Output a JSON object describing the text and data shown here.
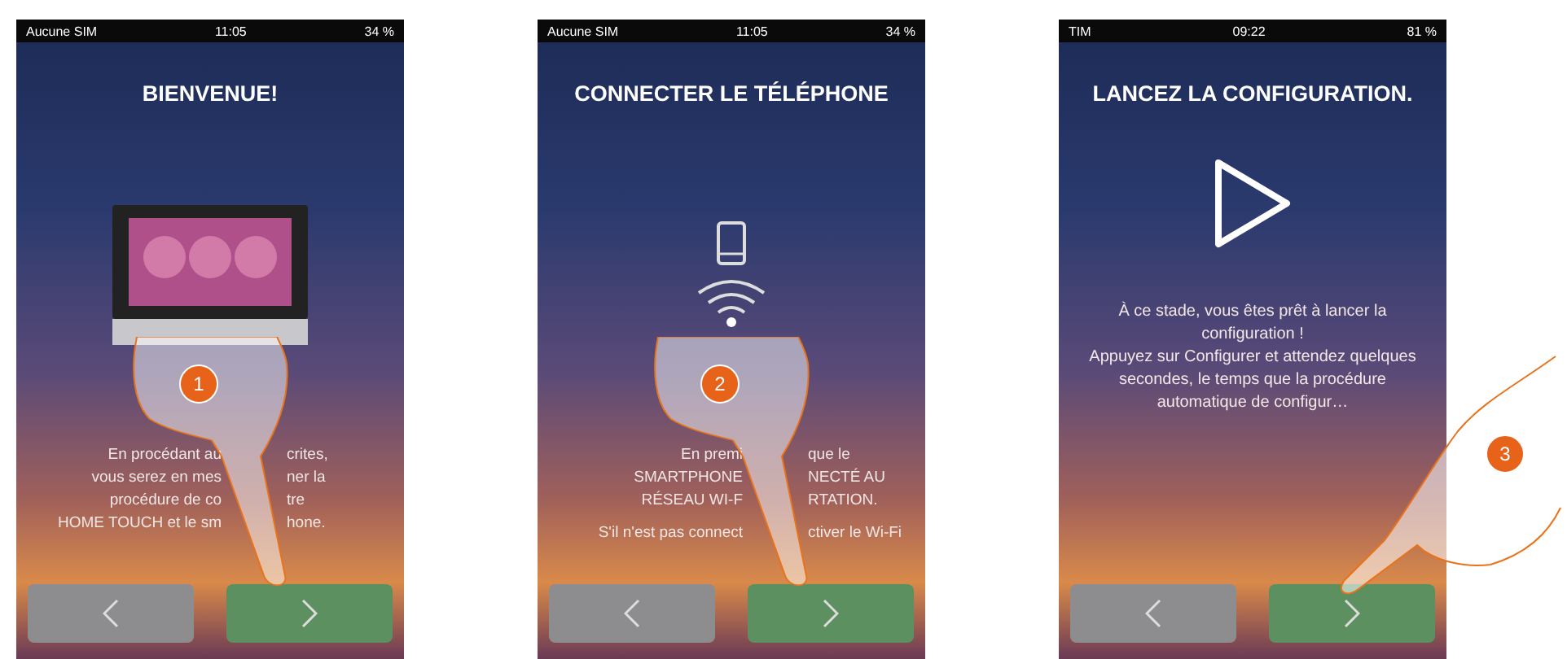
{
  "screens": [
    {
      "status": {
        "carrier": "Aucune SIM",
        "time": "11:05",
        "battery": "34 %"
      },
      "title": "BIENVENUE!",
      "kind": "device",
      "paragraphs": [
        [
          {
            "left": "En procédant au",
            "right": "crites,"
          },
          {
            "left": "vous serez en mes",
            "right": "ner la"
          },
          {
            "left": "procédure de co",
            "right": "tre"
          },
          {
            "left": "HOME TOUCH et le sm",
            "right": "hone."
          }
        ]
      ],
      "hand": {
        "kind": "top"
      },
      "badge": "1"
    },
    {
      "status": {
        "carrier": "Aucune SIM",
        "time": "11:05",
        "battery": "34 %"
      },
      "title": "CONNECTER LE TÉLÉPHONE",
      "kind": "phone-wifi",
      "paragraphs": [
        [
          {
            "left": "En premi",
            "right": "que le"
          },
          {
            "left": "SMARTPHONE",
            "right": "NECTÉ AU"
          },
          {
            "left": "RÉSEAU WI-F",
            "right": "RTATION."
          }
        ],
        [
          {
            "left": "S'il n'est pas connect",
            "right": "ctiver le Wi-Fi"
          }
        ]
      ],
      "hand": {
        "kind": "top"
      },
      "badge": "2"
    },
    {
      "status": {
        "carrier": "TIM",
        "time": "09:22",
        "battery": "81 %"
      },
      "title": "LANCEZ LA CONFIGURATION.",
      "kind": "play",
      "paragraphs": [
        [
          {
            "left": "À ce stade, vous êtes prêt à lancer la configuration !"
          },
          {
            "left": "Appuyez sur Configurer et attendez quelques secondes, le temps que la procédure automatique de configur…"
          }
        ]
      ],
      "hand": {
        "kind": "side"
      },
      "badge": "3"
    }
  ]
}
